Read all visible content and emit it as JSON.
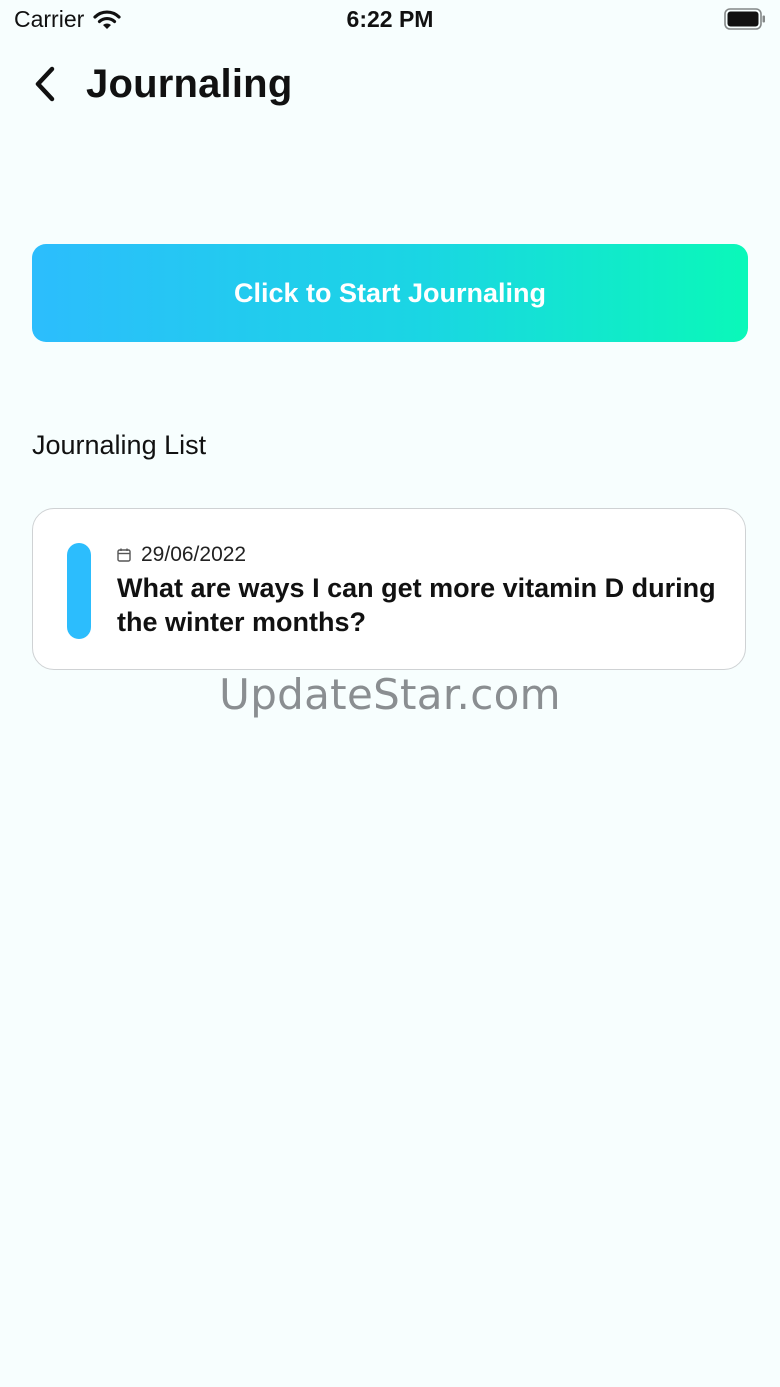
{
  "status_bar": {
    "carrier": "Carrier",
    "time": "6:22 PM"
  },
  "header": {
    "title": "Journaling",
    "back_icon": "chevron-left-icon"
  },
  "actions": {
    "start_label": "Click to Start Journaling"
  },
  "journal_list": {
    "title": "Journaling List",
    "items": [
      {
        "date": "29/06/2022",
        "title": "What are ways I can get more vitamin D during the winter months?"
      }
    ]
  },
  "watermark": "UpdateStar.com",
  "colors": {
    "background": "#f7fefe",
    "gradient_start": "#2cbdfd",
    "gradient_end": "#0af8b9",
    "accent": "#2cbdfd"
  }
}
